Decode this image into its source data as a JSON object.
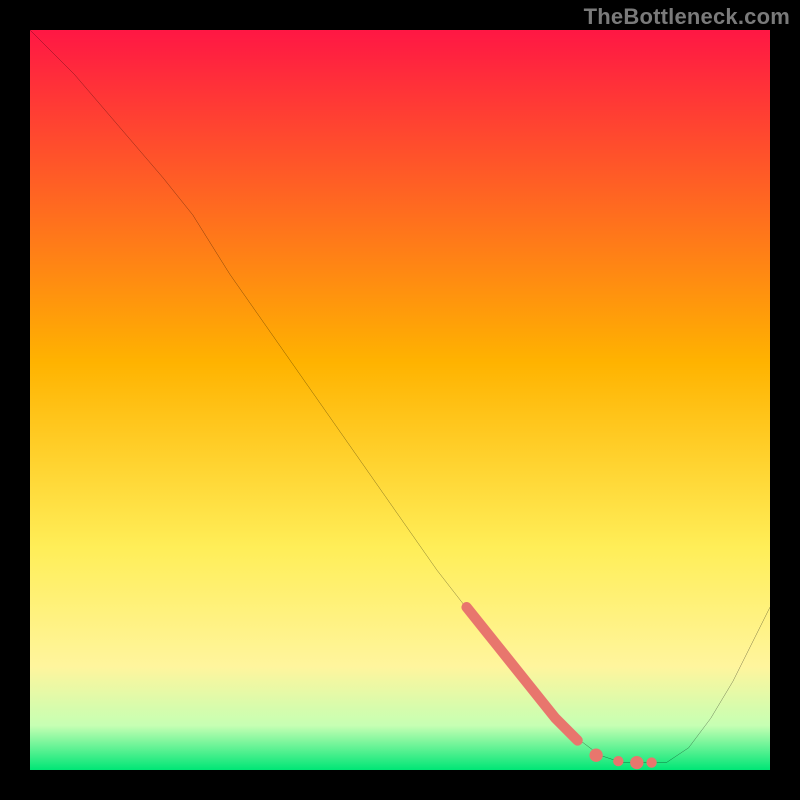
{
  "attribution": "TheBottleneck.com",
  "colors": {
    "frame": "#000000",
    "curve": "#000000",
    "highlight": "#e8766d",
    "dots": "#e8766d",
    "gradient_stops": [
      {
        "offset": 0,
        "color": "#ff1744"
      },
      {
        "offset": 45,
        "color": "#ffb300"
      },
      {
        "offset": 70,
        "color": "#ffee58"
      },
      {
        "offset": 86,
        "color": "#fff59d"
      },
      {
        "offset": 94,
        "color": "#c6ffb3"
      },
      {
        "offset": 100,
        "color": "#00e676"
      }
    ]
  },
  "chart_data": {
    "type": "line",
    "title": "",
    "xlabel": "",
    "ylabel": "",
    "xlim": [
      0,
      100
    ],
    "ylim": [
      0,
      100
    ],
    "note": "y expressed as bottleneck % (100=top/red, 0=bottom/green). Values estimated from pixel positions.",
    "series": [
      {
        "name": "bottleneck-curve",
        "x": [
          0,
          6,
          12,
          18,
          22,
          27,
          34,
          41,
          48,
          55,
          62,
          68,
          73,
          77,
          80,
          83,
          86,
          89,
          92,
          95,
          98,
          100
        ],
        "y": [
          100,
          94,
          87,
          80,
          75,
          67,
          57,
          47,
          37,
          27,
          18,
          11,
          5,
          2,
          1,
          1,
          1,
          3,
          7,
          12,
          18,
          22
        ]
      }
    ],
    "highlight_segment": {
      "name": "optimal-range-marker",
      "x": [
        59,
        63,
        67,
        71,
        74
      ],
      "y": [
        22,
        17,
        12,
        7,
        4
      ]
    },
    "valley_dots": {
      "x": [
        76.5,
        79.5,
        82.0,
        84.0
      ],
      "y": [
        2.0,
        1.2,
        1.0,
        1.0
      ],
      "r": [
        0.9,
        0.7,
        0.9,
        0.7
      ]
    }
  }
}
